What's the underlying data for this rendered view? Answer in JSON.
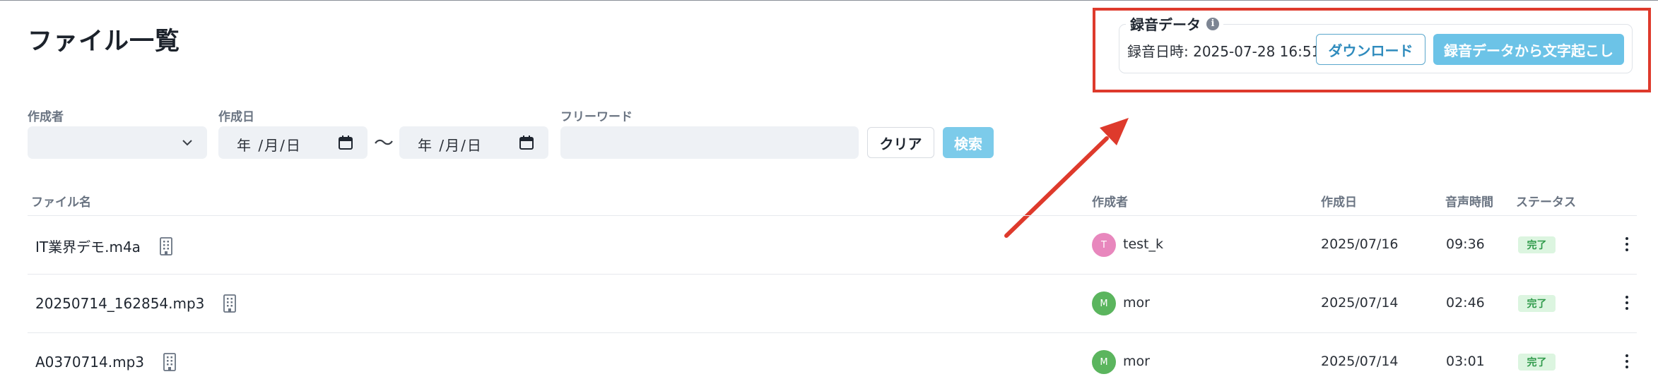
{
  "page": {
    "title": "ファイル一覧"
  },
  "filters": {
    "creator_label": "作成者",
    "created_label": "作成日",
    "date_from_text": "年 /月/日",
    "range_separator": "〜",
    "date_to_text": "年 /月/日",
    "freeword_label": "フリーワード",
    "freeword_value": "",
    "clear_label": "クリア",
    "search_label": "検索"
  },
  "recording_panel": {
    "title": "録音データ",
    "info_icon": "info-icon",
    "recorded_at": "録音日時: 2025-07-28 16:51",
    "download_label": "ダウンロード",
    "transcribe_label": "録音データから文字起こし",
    "highlight_color": "#de3a2c"
  },
  "table": {
    "headers": {
      "file_name": "ファイル名",
      "creator": "作成者",
      "created": "作成日",
      "duration": "音声時間",
      "status": "ステータス"
    },
    "rows": [
      {
        "file_name": "IT業界デモ.m4a",
        "avatar_initial": "T",
        "avatar_color": "#e887bd",
        "creator": "test_k",
        "created": "2025/07/16",
        "duration": "09:36",
        "status": "完了"
      },
      {
        "file_name": "20250714_162854.mp3",
        "avatar_initial": "M",
        "avatar_color": "#5bb55e",
        "creator": "mor",
        "created": "2025/07/14",
        "duration": "02:46",
        "status": "完了"
      },
      {
        "file_name": "A0370714.mp3",
        "avatar_initial": "M",
        "avatar_color": "#5bb55e",
        "creator": "mor",
        "created": "2025/07/14",
        "duration": "03:01",
        "status": "完了"
      }
    ]
  },
  "colors": {
    "accent": "#6cc3e7",
    "status_done_bg": "#dcf5e0",
    "status_done_text": "#2f9a4a"
  }
}
